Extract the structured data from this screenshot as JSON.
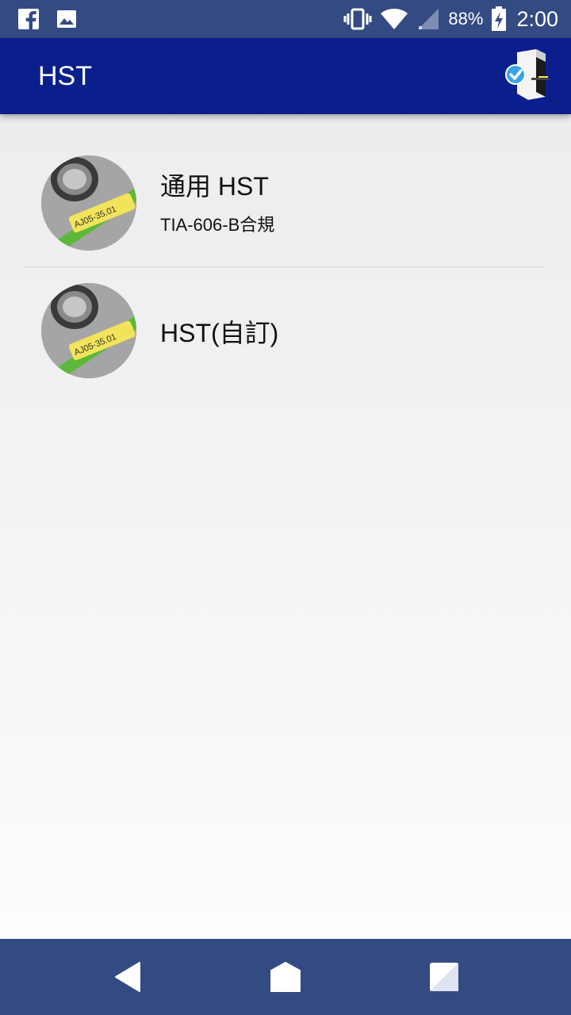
{
  "status_bar": {
    "notification_icons": [
      "facebook-icon",
      "image-icon"
    ],
    "system_icons": [
      "vibrate-icon",
      "wifi-icon",
      "cell-signal-icon",
      "battery-charging-icon"
    ],
    "battery_percent": "88%",
    "time": "2:00"
  },
  "app_bar": {
    "title": "HST",
    "action_icon": "printer-connected-icon"
  },
  "list": {
    "items": [
      {
        "title": "通用 HST",
        "subtitle": "TIA-606-B合規",
        "thumbnail_label": "AJ05-35.01"
      },
      {
        "title": "HST(自訂)",
        "thumbnail_label": "AJ05-35.01"
      }
    ]
  },
  "nav_bar": {
    "buttons": [
      "back-icon",
      "home-icon",
      "recents-icon"
    ]
  },
  "colors": {
    "status_bar": "#344a82",
    "app_bar": "#0b1f8c",
    "nav_bar": "#344a82",
    "label_yellow": "#f2e35a",
    "cable_green": "#5cb83a",
    "check_blue": "#3aa3e8"
  }
}
